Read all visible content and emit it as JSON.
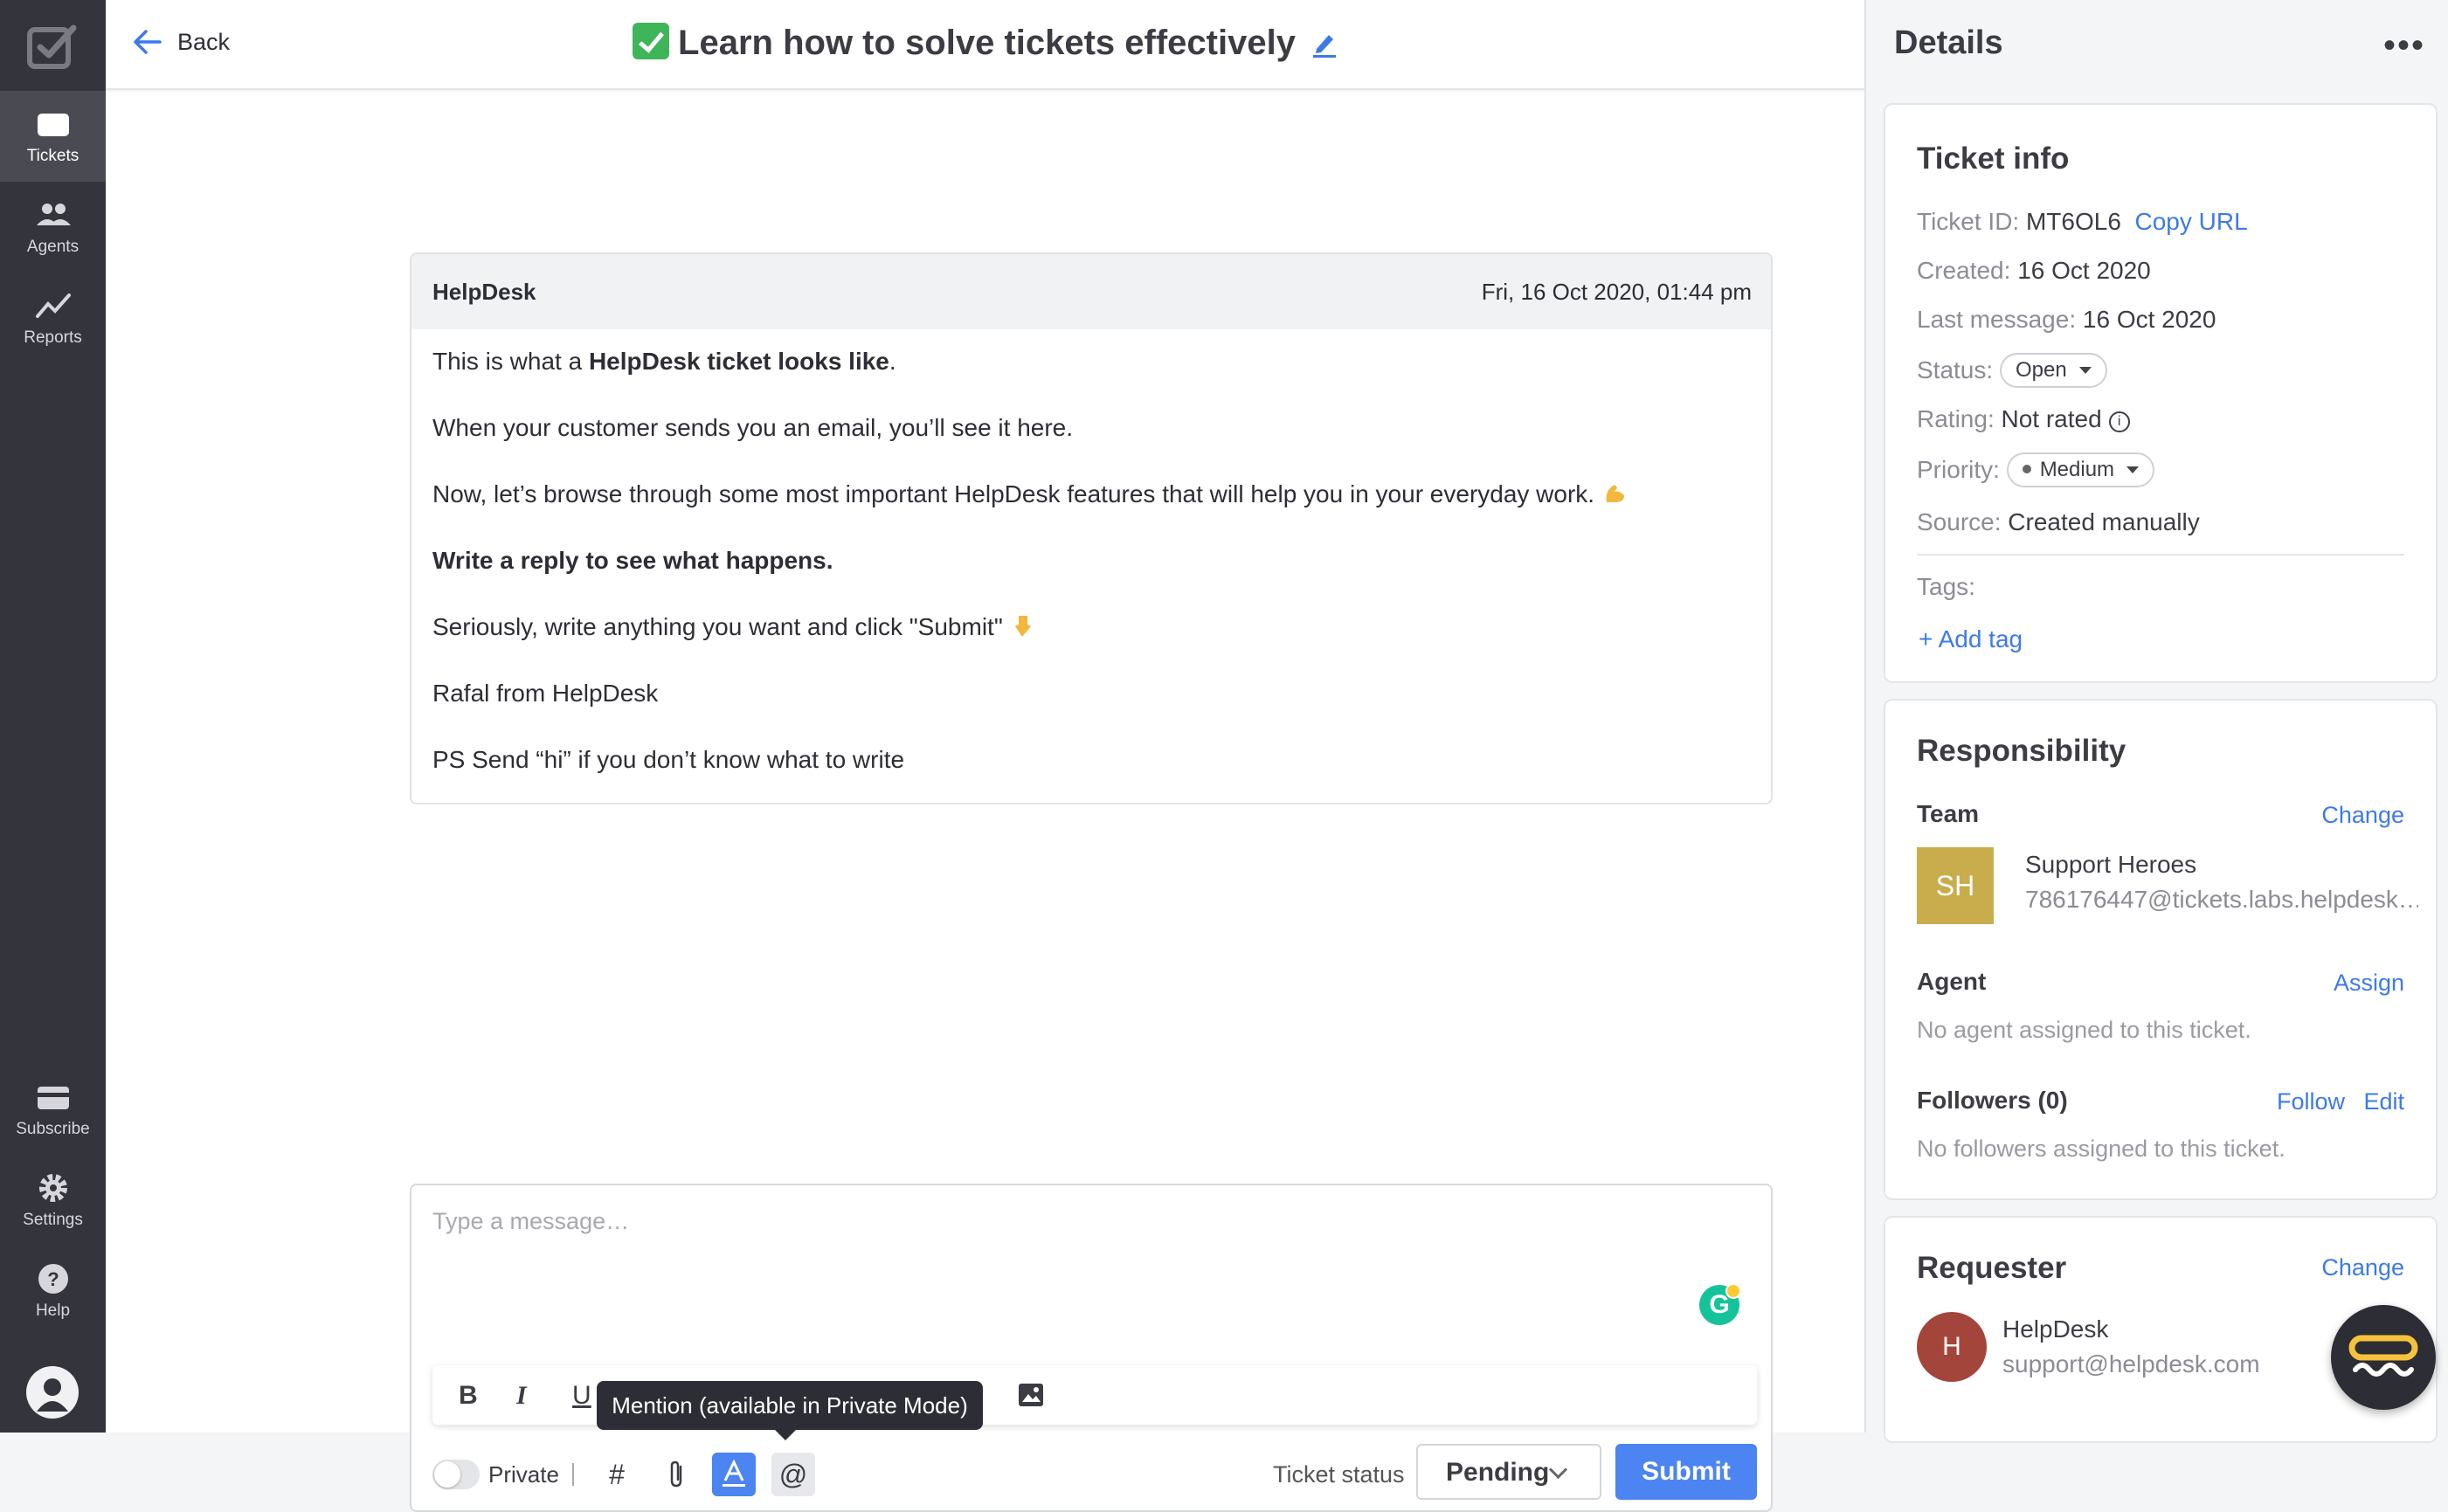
{
  "nav": {
    "items": [
      {
        "label": "Tickets",
        "active": true
      },
      {
        "label": "Agents"
      },
      {
        "label": "Reports"
      },
      {
        "label": "Subscribe"
      },
      {
        "label": "Settings"
      },
      {
        "label": "Help"
      }
    ]
  },
  "header": {
    "back_label": "Back",
    "title": "Learn how to solve tickets effectively"
  },
  "message": {
    "from": "HelpDesk",
    "date": "Fri, 16 Oct 2020, 01:44 pm",
    "line1_pre": "This is what a ",
    "line1_bold": "HelpDesk ticket looks like",
    "line1_post": ".",
    "line2": "When your customer sends you an email, you’ll see it here.",
    "line3": "Now, let’s browse through some most important HelpDesk features that will help you in your everyday work.",
    "line4": "Write a reply to see what happens.",
    "line5": "Seriously, write anything you want and click \"Submit\"",
    "line6": "Rafal from HelpDesk",
    "line7": "PS Send “hi” if you don’t know what to write"
  },
  "composer": {
    "placeholder": "Type a message…",
    "tooltip": "Mention (available in Private Mode)",
    "private_label": "Private",
    "ticket_status_label": "Ticket status",
    "ticket_status_value": "Pending",
    "submit_label": "Submit",
    "grammarly_glyph": "G"
  },
  "details": {
    "heading": "Details",
    "more_glyph": "•••",
    "ticket_info": {
      "heading": "Ticket info",
      "ticket_id_key": "Ticket ID:",
      "ticket_id": "MT6OL6",
      "copy_url": "Copy URL",
      "created_key": "Created:",
      "created": "16 Oct 2020",
      "last_message_key": "Last message:",
      "last_message": "16 Oct 2020",
      "status_key": "Status:",
      "status": "Open",
      "rating_key": "Rating:",
      "rating": "Not rated",
      "priority_key": "Priority:",
      "priority": "Medium",
      "source_key": "Source:",
      "source": "Created manually",
      "tags_key": "Tags:",
      "add_tag": "+ Add tag"
    },
    "responsibility": {
      "heading": "Responsibility",
      "team_label": "Team",
      "team_change": "Change",
      "team_initials": "SH",
      "team_name": "Support Heroes",
      "team_email": "786176447@tickets.labs.helpdesk…",
      "agent_label": "Agent",
      "agent_assign": "Assign",
      "agent_empty": "No agent assigned to this ticket.",
      "followers_label": "Followers (0)",
      "follow": "Follow",
      "edit": "Edit",
      "followers_empty": "No followers assigned to this ticket."
    },
    "requester": {
      "heading": "Requester",
      "change": "Change",
      "initial": "H",
      "name": "HelpDesk",
      "email": "support@helpdesk.com"
    }
  },
  "colors": {
    "accent": "#4c84f1",
    "nav_bg": "#34343c",
    "link": "#3d7ae8"
  }
}
